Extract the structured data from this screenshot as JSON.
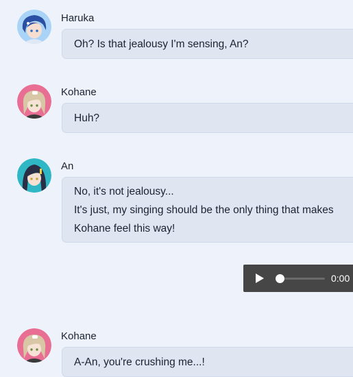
{
  "messages": [
    {
      "speaker": "Haruka",
      "avatar_icon": "haruka-avatar",
      "avatar_color": "#6fa8e8",
      "lines": [
        "Oh? Is that jealousy I'm sensing, An?"
      ]
    },
    {
      "speaker": "Kohane",
      "avatar_icon": "kohane-avatar",
      "avatar_color": "#e86f93",
      "lines": [
        "Huh?"
      ]
    },
    {
      "speaker": "An",
      "avatar_icon": "an-avatar",
      "avatar_color": "#2fb7c6",
      "lines": [
        "No, it's not jealousy...",
        "It's just, my singing should be the only thing that makes",
        "Kohane feel this way!"
      ]
    },
    {
      "speaker": "Kohane",
      "avatar_icon": "kohane-avatar",
      "avatar_color": "#e86f93",
      "lines": [
        "A-An, you're crushing me...!"
      ]
    }
  ],
  "audio_player": {
    "time": "0:00",
    "progress": 0,
    "play_icon": "play-icon"
  },
  "colors": {
    "background": "#eef2fa",
    "bubble": "#dfe6f2",
    "player": "#464646"
  }
}
